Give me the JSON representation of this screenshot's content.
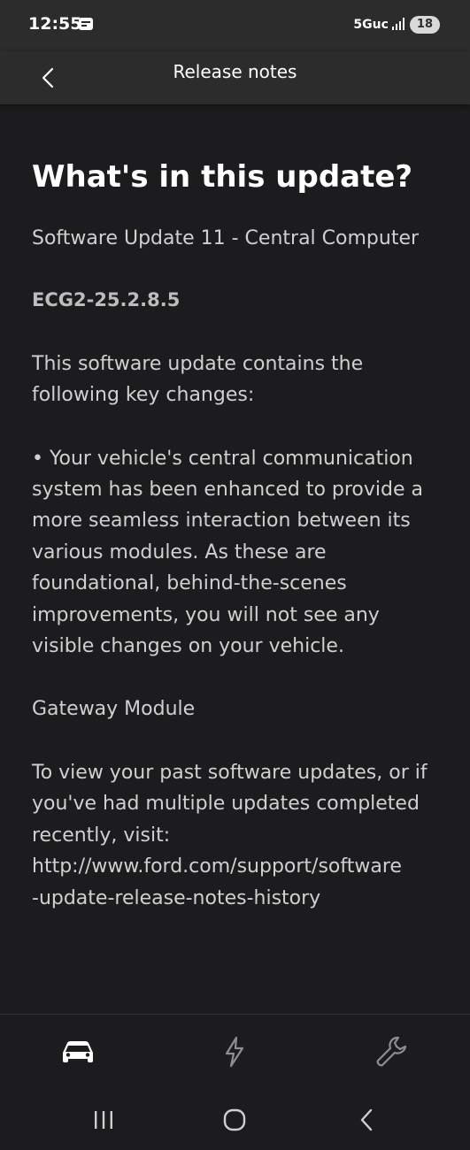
{
  "status_bar": {
    "time": "12:55",
    "network": "5Guc",
    "battery": "18"
  },
  "header": {
    "title": "Release notes"
  },
  "content": {
    "heading": "What's in this update?",
    "subtitle": "Software Update 11 - Central Computer",
    "version": "ECG2-25.2.8.5",
    "intro": "This software update contains the following key changes:",
    "bullet": "• Your vehicle's central communication system has been enhanced to provide a more seamless interaction between its various modules. As these are foundational, behind-the-scenes improvements, you will not see any visible changes on your vehicle.",
    "module": "Gateway Module",
    "history_line1": "To view your past software updates, or if you've had multiple updates completed recently, visit:",
    "history_line2": "http://www.ford.com/support/software",
    "history_line3": "-update-release-notes-history"
  },
  "bottom_nav": {
    "items": [
      {
        "icon": "vehicle-icon"
      },
      {
        "icon": "charge-icon"
      },
      {
        "icon": "wrench-icon"
      }
    ]
  },
  "colors": {
    "background": "#1c1c1e",
    "header": "#2c2c2c",
    "text": "#d0d0d0"
  }
}
